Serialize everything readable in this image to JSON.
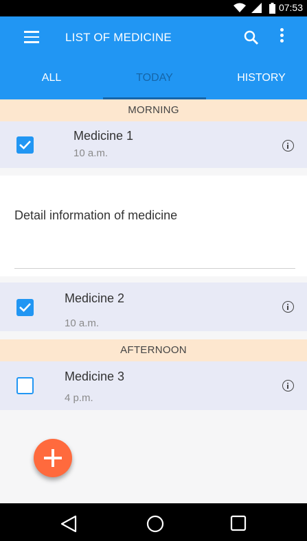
{
  "status_bar": {
    "time": "07:53"
  },
  "app_bar": {
    "title": "LIST OF MEDICINE"
  },
  "tabs": [
    {
      "label": "ALL"
    },
    {
      "label": "TODAY",
      "active": true
    },
    {
      "label": "HISTORY"
    }
  ],
  "sections": {
    "morning": "MORNING",
    "afternoon": "AFTERNOON"
  },
  "medicines": [
    {
      "name": "Medicine 1",
      "time": "10 a.m.",
      "checked": true
    },
    {
      "name": "Medicine 2",
      "time": "10 a.m.",
      "checked": true
    },
    {
      "name": "Medicine 3",
      "time": "4 p.m.",
      "checked": false
    }
  ],
  "detail": {
    "text": "Detail information of medicine"
  },
  "colors": {
    "primary": "#2196f3",
    "accent": "#ff6a3d",
    "section_bg": "#fde7cf",
    "row_bg": "#e8eaf6"
  },
  "icons": [
    "menu-icon",
    "search-icon",
    "more-vert-icon",
    "info-icon",
    "add-icon",
    "back-icon",
    "home-icon",
    "recents-icon"
  ]
}
